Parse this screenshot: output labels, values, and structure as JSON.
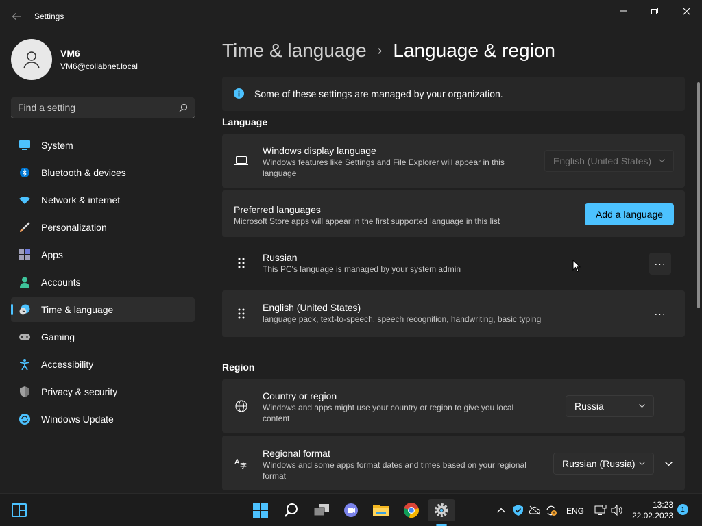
{
  "window": {
    "title": "Settings",
    "back_icon": "arrow-left-icon",
    "minimize_icon": "minimize-icon",
    "maximize_icon": "restore-icon",
    "close_icon": "close-icon"
  },
  "profile": {
    "name": "VM6",
    "email": "VM6@collabnet.local"
  },
  "search": {
    "placeholder": "Find a setting",
    "icon": "search-icon"
  },
  "sidebar": {
    "items": [
      {
        "label": "System",
        "icon": "system-icon",
        "color": "#4cc2ff"
      },
      {
        "label": "Bluetooth & devices",
        "icon": "bluetooth-icon",
        "color": "#0078d4"
      },
      {
        "label": "Network & internet",
        "icon": "wifi-icon",
        "color": "#4cc2ff"
      },
      {
        "label": "Personalization",
        "icon": "brush-icon",
        "color": "#f0a060"
      },
      {
        "label": "Apps",
        "icon": "apps-icon",
        "color": "#a0a0b8"
      },
      {
        "label": "Accounts",
        "icon": "person-icon",
        "color": "#3ec39a"
      },
      {
        "label": "Time & language",
        "icon": "clock-globe-icon",
        "color": "#4cc2ff",
        "selected": true
      },
      {
        "label": "Gaming",
        "icon": "gamepad-icon",
        "color": "#b0b0b0"
      },
      {
        "label": "Accessibility",
        "icon": "accessibility-icon",
        "color": "#4cc2ff"
      },
      {
        "label": "Privacy & security",
        "icon": "shield-icon",
        "color": "#a0a0a0"
      },
      {
        "label": "Windows Update",
        "icon": "update-icon",
        "color": "#4cc2ff"
      }
    ]
  },
  "breadcrumb": {
    "parent": "Time & language",
    "separator": "›",
    "current": "Language & region"
  },
  "info_banner": {
    "text": "Some of these settings are managed by your organization."
  },
  "language_section": {
    "label": "Language",
    "display_language": {
      "title": "Windows display language",
      "subtitle": "Windows features like Settings and File Explorer will appear in this language",
      "value": "English (United States)"
    },
    "preferred": {
      "title": "Preferred languages",
      "subtitle": "Microsoft Store apps will appear in the first supported language in this list",
      "button": "Add a language"
    },
    "languages": [
      {
        "name": "Russian",
        "detail": "This PC's language is managed by your system admin"
      },
      {
        "name": "English (United States)",
        "detail": "language pack, text-to-speech, speech recognition, handwriting, basic typing"
      }
    ],
    "more_label": "···"
  },
  "region_section": {
    "label": "Region",
    "country": {
      "title": "Country or region",
      "subtitle": "Windows and apps might use your country or region to give you local content",
      "value": "Russia"
    },
    "format": {
      "title": "Regional format",
      "subtitle": "Windows and some apps format dates and times based on your regional format",
      "value": "Russian (Russia)"
    }
  },
  "taskbar": {
    "language": "ENG",
    "time": "13:23",
    "date": "22.02.2023",
    "notifications": "1",
    "accent": "#4cc2ff"
  }
}
